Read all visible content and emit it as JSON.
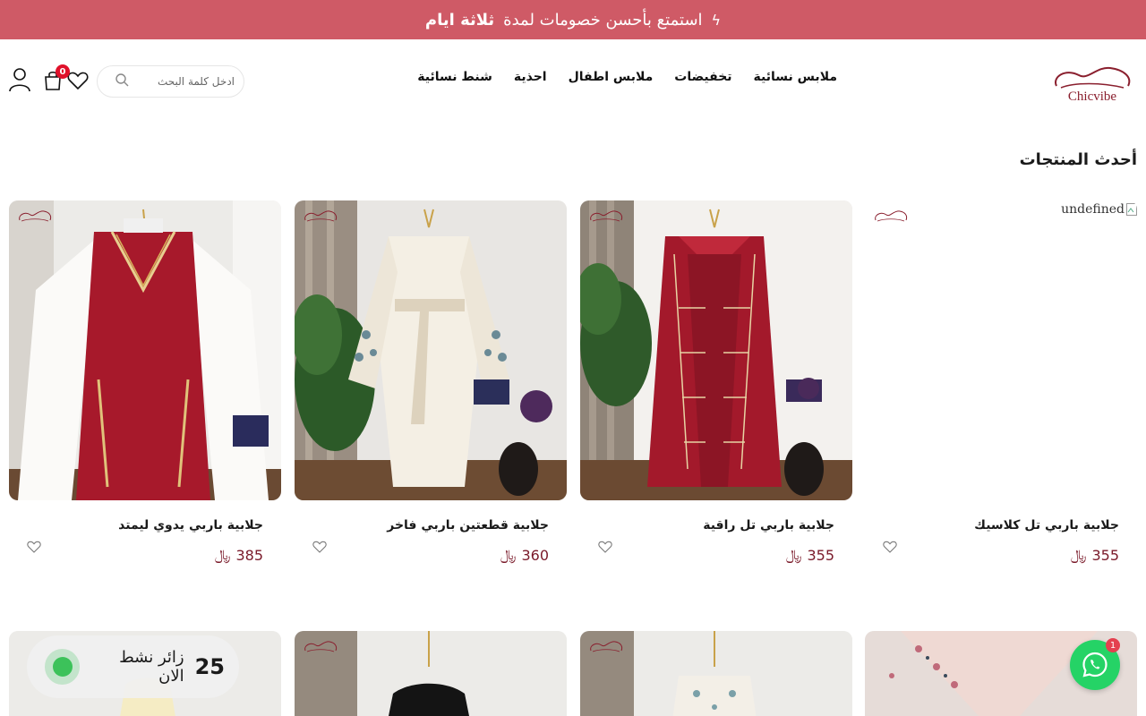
{
  "announcement": {
    "text": "استمتع بأحسن خصومات لمدة",
    "bold": "ثلاثة ايام",
    "icon": "lightning-icon"
  },
  "header": {
    "logo_text": "Chicvibe",
    "nav": [
      "ملابس نسائية",
      "تخفيضات",
      "ملابس اطفال",
      "احذية",
      "شنط نسائية"
    ],
    "search_placeholder": "ادخل كلمة البحث",
    "cart_count": "0"
  },
  "section": {
    "title": "أحدث المنتجات"
  },
  "products": [
    {
      "name": "جلابية باربي تل كلاسيك",
      "price": "355",
      "currency": "﷼",
      "image_alt": "undefined",
      "image_broken": true
    },
    {
      "name": "جلابية باربي تل راقية",
      "price": "355",
      "currency": "﷼"
    },
    {
      "name": "جلابية قطعتين باربي فاخر",
      "price": "360",
      "currency": "﷼"
    },
    {
      "name": "جلابية باربي يدوي ليمتد",
      "price": "385",
      "currency": "﷼"
    }
  ],
  "visitors": {
    "count": "25",
    "label": "زائر نشط الان"
  },
  "whatsapp": {
    "badge": "1"
  },
  "colors": {
    "accent": "#cf5a66",
    "price": "#7a1a2a",
    "whatsapp": "#25d366"
  }
}
